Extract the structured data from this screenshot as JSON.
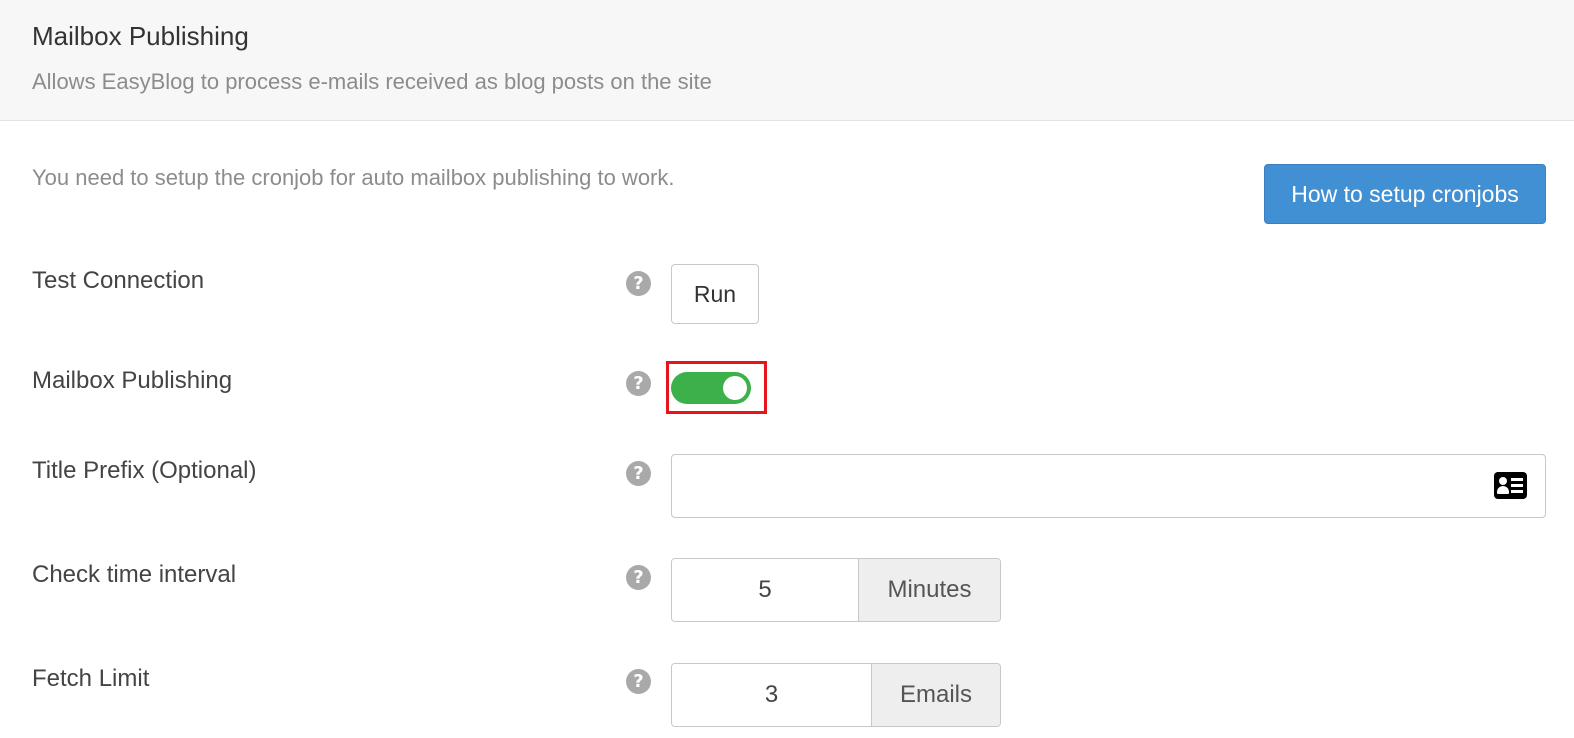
{
  "header": {
    "title": "Mailbox Publishing",
    "description": "Allows EasyBlog to process e-mails received as blog posts on the site"
  },
  "notice": {
    "text": "You need to setup the cronjob for auto mailbox publishing to work.",
    "button_label": "How to setup cronjobs"
  },
  "help_glyph": "?",
  "rows": {
    "test_connection": {
      "label": "Test Connection",
      "button_label": "Run"
    },
    "mailbox_publishing": {
      "label": "Mailbox Publishing",
      "enabled": true
    },
    "title_prefix": {
      "label": "Title Prefix (Optional)",
      "value": "",
      "icon": "id-card-icon"
    },
    "check_interval": {
      "label": "Check time interval",
      "value": "5",
      "unit": "Minutes"
    },
    "fetch_limit": {
      "label": "Fetch Limit",
      "value": "3",
      "unit": "Emails"
    }
  },
  "colors": {
    "primary": "#4190d3",
    "toggle_on": "#3cb049",
    "highlight": "#e8141c"
  }
}
